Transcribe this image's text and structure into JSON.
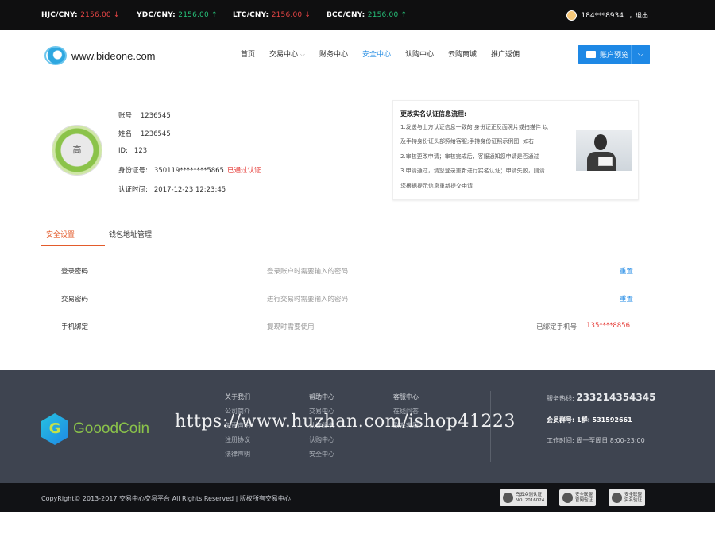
{
  "ticker": {
    "items": [
      {
        "pair": "HJC/CNY:",
        "value": "2156.00 ↓",
        "color": "#e64545"
      },
      {
        "pair": "YDC/CNY:",
        "value": "2156.00 ↑",
        "color": "#27c27a"
      },
      {
        "pair": "LTC/CNY:",
        "value": "2156.00 ↓",
        "color": "#e64545"
      },
      {
        "pair": "BCC/CNY:",
        "value": "2156.00 ↑",
        "color": "#27c27a"
      }
    ],
    "user": "184***8934",
    "logout": "，退出"
  },
  "header": {
    "logo_text": "www.bideone.com",
    "nav": [
      {
        "label": "首页"
      },
      {
        "label": "交易中心",
        "caret": "⌵"
      },
      {
        "label": "财务中心"
      },
      {
        "label": "安全中心",
        "active": true
      },
      {
        "label": "认购中心"
      },
      {
        "label": "云购商城"
      },
      {
        "label": "推广返佣"
      }
    ],
    "account_button": "账户预览",
    "account_chevron": "⌵"
  },
  "profile": {
    "level": "高",
    "rows": [
      {
        "label": "账号:",
        "value": "1236545"
      },
      {
        "label": "姓名:",
        "value": "1236545"
      },
      {
        "label": "ID:",
        "value": "123"
      },
      {
        "label": "身份证号:",
        "value": "350119********5865",
        "badge": "已通过认证"
      },
      {
        "label": "认证时间:",
        "value": "2017-12-23 12:23:45"
      }
    ]
  },
  "notice": {
    "title": "更改实名认证信息流程:",
    "lines": [
      "1.发送与上方认证信息一致的 身份证正反面照片或扫描件 以",
      "及手持身份证头部照给客服;手持身份证照示例图: 如右",
      "2.审核更改申请；审核完成后，客服通知您申请是否通过",
      "3.申请通过，请您登录重新进行实名认证；申请失败，则请",
      "您根据提示信息重新提交申请"
    ]
  },
  "tabs": [
    "安全设置",
    "钱包地址管理"
  ],
  "security_rows": [
    {
      "name": "登录密码",
      "desc": "登录账户时需要输入的密码",
      "action": "重置"
    },
    {
      "name": "交易密码",
      "desc": "进行交易时需要输入的密码",
      "action": "重置"
    },
    {
      "name": "手机绑定",
      "desc": "提现时需要使用",
      "phone_label": "已绑定手机号:",
      "phone": "135****8856"
    }
  ],
  "footer": {
    "brand": "GooodCoin",
    "columns": [
      [
        "关于我们",
        "公司简介",
        "免责声明",
        "注册协议",
        "法律声明"
      ],
      [
        "帮助中心",
        "交易中心",
        "认证服务",
        "认购中心",
        "安全中心"
      ],
      [
        "客服中心",
        "在线问答",
        "联系客服"
      ]
    ],
    "hotline_label": "服务热线:",
    "hotline": "233214354345",
    "qq_label": "会员群号:",
    "qq_group": "1群: 531592661",
    "work_label": "工作时间:",
    "work_hours": "周一至周日 8:00-23:00"
  },
  "bottom": {
    "copyright": "CopyRight© 2013-2017 交易中心交易平台 All Rights Reserved | 版权所有交易中心",
    "certs": [
      {
        "l1": "乌云众测认证",
        "l2": "NO. 2016024"
      },
      {
        "l1": "安全联盟",
        "l2": "官网验证"
      },
      {
        "l1": "安全联盟",
        "l2": "实名验证"
      }
    ]
  },
  "watermark": "https://www.huzhan.com/ishop41223"
}
